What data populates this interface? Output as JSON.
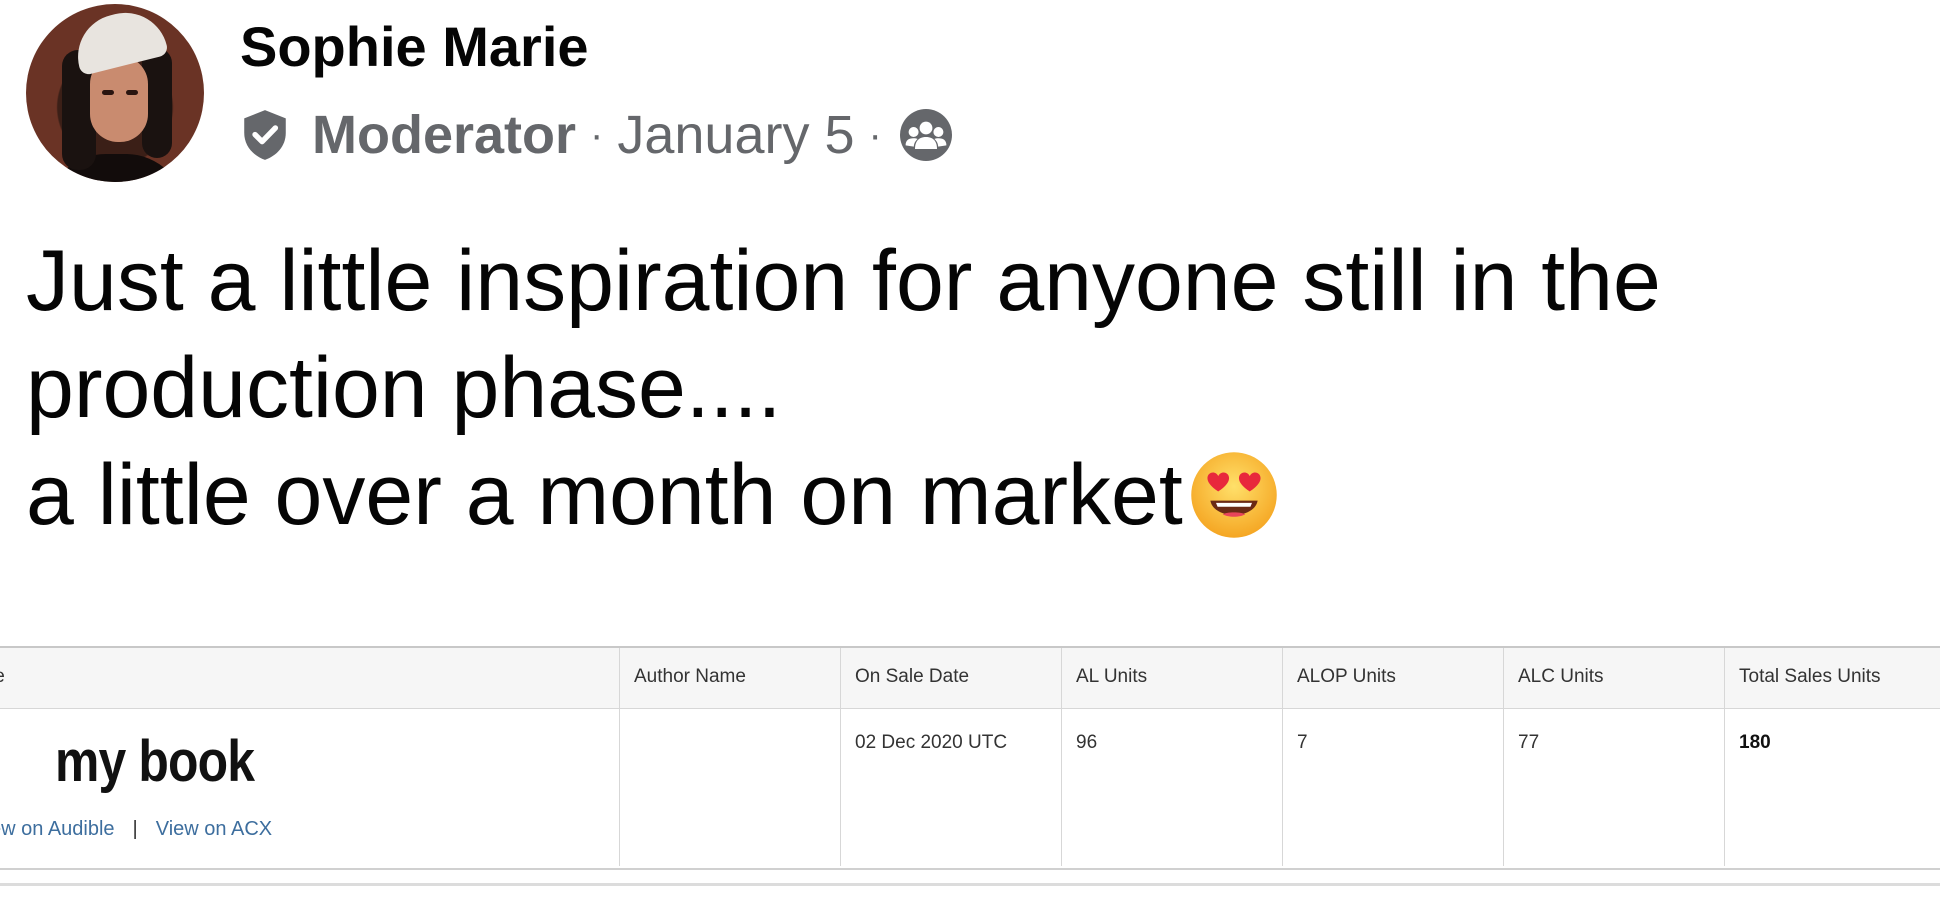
{
  "post": {
    "author": "Sophie Marie",
    "role": "Moderator",
    "separator": "·",
    "date": "January 5",
    "text_lines": [
      "Just a little inspiration for anyone still in the",
      "production phase....",
      "a little over a month on market"
    ]
  },
  "icons": {
    "badge": "shield-check-icon",
    "audience": "group-icon",
    "emoji": "heart-eyes-emoji"
  },
  "table": {
    "headers": {
      "title": "le",
      "author": "Author Name",
      "on_sale": "On Sale Date",
      "al": "AL Units",
      "alop": "ALOP Units",
      "alc": "ALC Units",
      "total": "Total Sales Units"
    },
    "row": {
      "book_title": "my book",
      "link_audible": "ew on Audible",
      "link_sep": "|",
      "link_acx": "View on ACX",
      "author": "",
      "on_sale": "02 Dec 2020 UTC",
      "al": "96",
      "alop": "7",
      "alc": "77",
      "total": "180"
    }
  },
  "colors": {
    "text": "#050505",
    "meta": "#65676b",
    "link": "#3d6e9e",
    "table_header_bg": "#f6f6f6",
    "border": "#d7d7d7"
  }
}
